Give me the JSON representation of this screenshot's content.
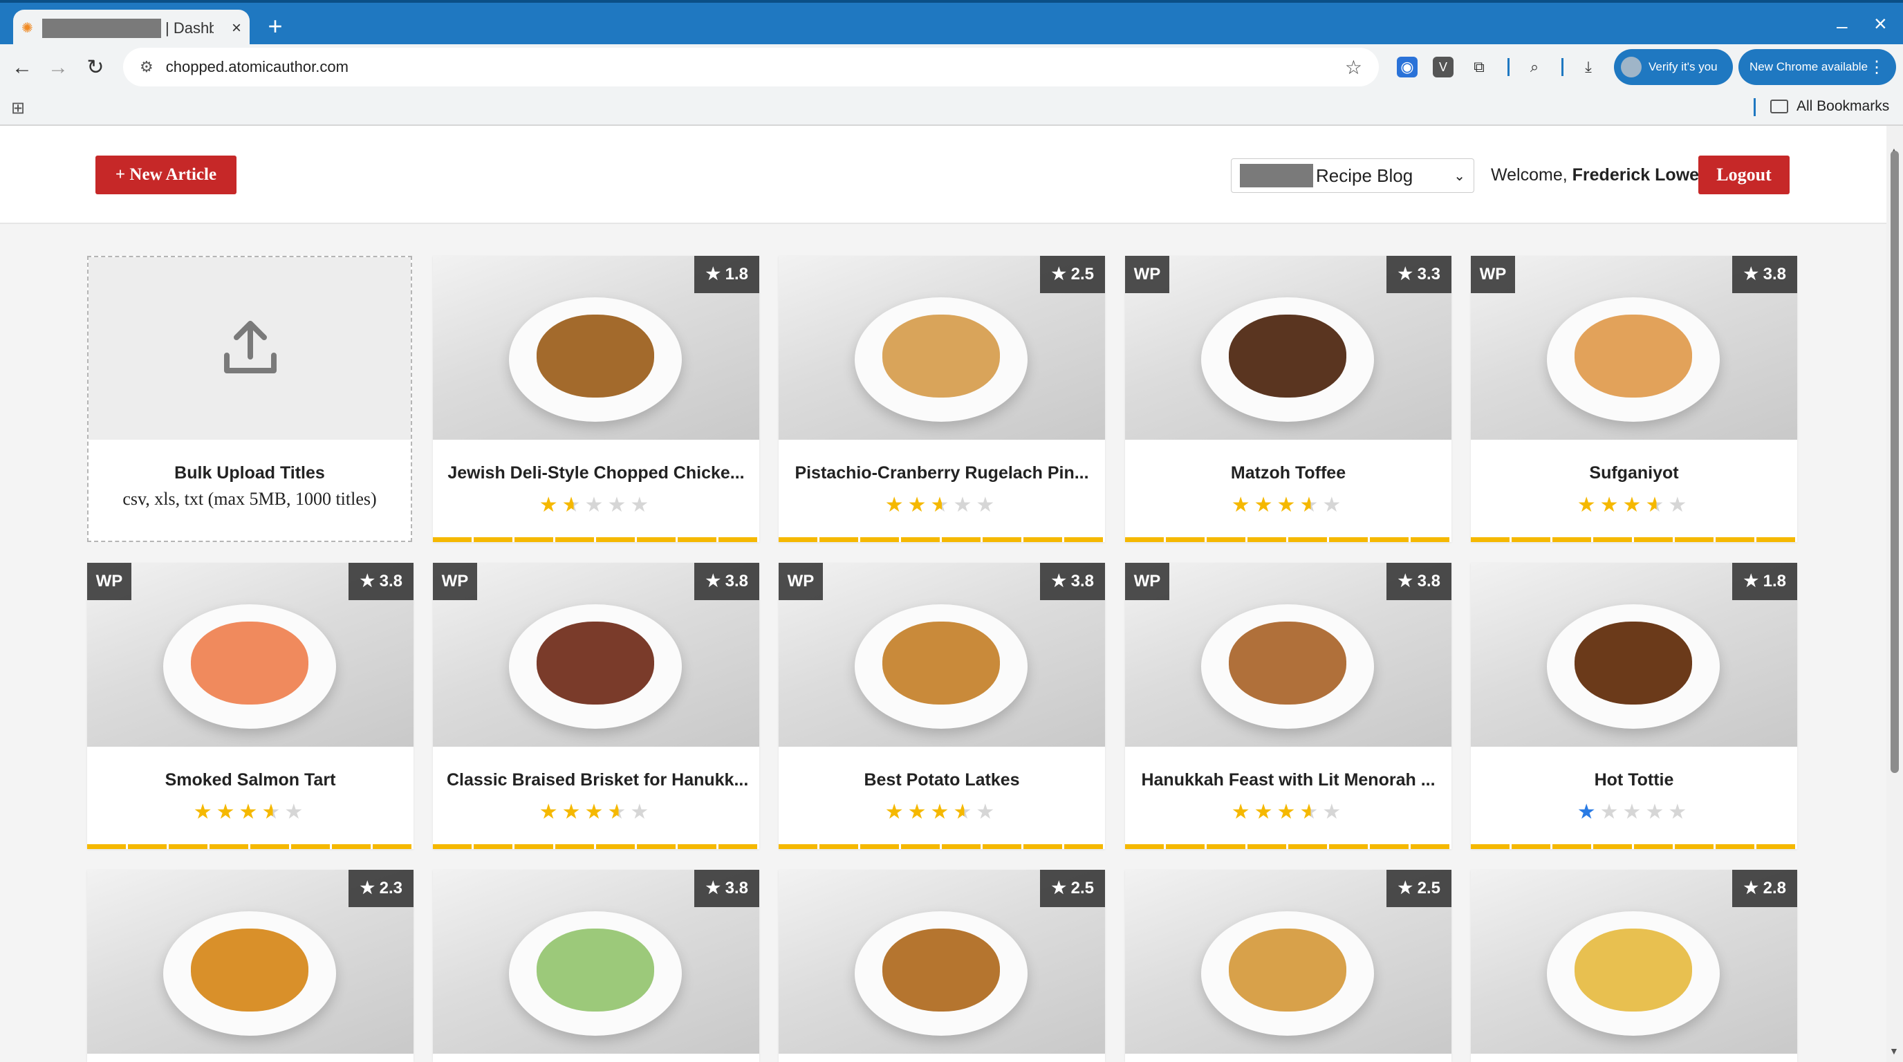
{
  "browser": {
    "tab_title": "| Dashbo",
    "new_tab": "+",
    "url": "chopped.atomicauthor.com",
    "verify_label": "Verify it's you",
    "new_chrome_label": "New Chrome available",
    "all_bookmarks": "All Bookmarks"
  },
  "header": {
    "new_article_label": "+ New Article",
    "blog_selector_value": "Recipe Blog",
    "welcome_prefix": "Welcome, ",
    "user_name": "Frederick Lowe",
    "logout_label": "Logout"
  },
  "upload": {
    "title": "Bulk Upload Titles",
    "subtitle": "csv, xls, txt (max 5MB, 1000 titles)"
  },
  "articles": [
    {
      "title": "Jewish Deli-Style Chopped Chicke...",
      "rating": "★ 1.8",
      "rating_value": 1.8,
      "wp": false,
      "stars": [
        2,
        1,
        0,
        0,
        0
      ],
      "food_color": "#a36a2c"
    },
    {
      "title": "Pistachio-Cranberry Rugelach Pin...",
      "rating": "★ 2.5",
      "rating_value": 2.5,
      "wp": false,
      "stars": [
        2,
        2,
        1,
        0,
        0
      ],
      "food_color": "#d9a45a"
    },
    {
      "title": "Matzoh Toffee",
      "rating": "★ 3.3",
      "rating_value": 3.3,
      "wp": true,
      "stars": [
        2,
        2,
        2,
        1,
        0
      ],
      "food_color": "#5a3520"
    },
    {
      "title": "Sufganiyot",
      "rating": "★ 3.8",
      "rating_value": 3.8,
      "wp": true,
      "stars": [
        2,
        2,
        2,
        1,
        0
      ],
      "food_color": "#e2a25a"
    },
    {
      "title": "Smoked Salmon Tart",
      "rating": "★ 3.8",
      "rating_value": 3.8,
      "wp": true,
      "stars": [
        2,
        2,
        2,
        1,
        0
      ],
      "food_color": "#f08a5d"
    },
    {
      "title": "Classic Braised Brisket for Hanukk...",
      "rating": "★ 3.8",
      "rating_value": 3.8,
      "wp": true,
      "stars": [
        2,
        2,
        2,
        1,
        0
      ],
      "food_color": "#7a3b2a"
    },
    {
      "title": "Best Potato Latkes",
      "rating": "★ 3.8",
      "rating_value": 3.8,
      "wp": true,
      "stars": [
        2,
        2,
        2,
        1,
        0
      ],
      "food_color": "#c98a3a"
    },
    {
      "title": "Hanukkah Feast with Lit Menorah ...",
      "rating": "★ 3.8",
      "rating_value": 3.8,
      "wp": true,
      "stars": [
        2,
        2,
        2,
        1,
        0
      ],
      "food_color": "#b0703a"
    },
    {
      "title": "Hot Tottie",
      "rating": "★ 1.8",
      "rating_value": 1.8,
      "wp": false,
      "stars": [
        3,
        0,
        0,
        0,
        0
      ],
      "food_color": "#6b3a1a"
    },
    {
      "title": "",
      "rating": "★ 2.3",
      "rating_value": 2.3,
      "wp": false,
      "stars": [],
      "food_color": "#d9902a"
    },
    {
      "title": "",
      "rating": "★ 3.8",
      "rating_value": 3.8,
      "wp": false,
      "stars": [],
      "food_color": "#9cc97a"
    },
    {
      "title": "",
      "rating": "★ 2.5",
      "rating_value": 2.5,
      "wp": false,
      "stars": [],
      "food_color": "#b5752f"
    },
    {
      "title": "",
      "rating": "★ 2.5",
      "rating_value": 2.5,
      "wp": false,
      "stars": [],
      "food_color": "#d8a14a"
    },
    {
      "title": "",
      "rating": "★ 2.8",
      "rating_value": 2.8,
      "wp": false,
      "stars": [],
      "food_color": "#e8c050"
    }
  ],
  "labels": {
    "wp": "WP"
  },
  "colors": {
    "accent_red": "#c62828",
    "star_gold": "#f5b800",
    "browser_blue": "#1f78c1"
  }
}
